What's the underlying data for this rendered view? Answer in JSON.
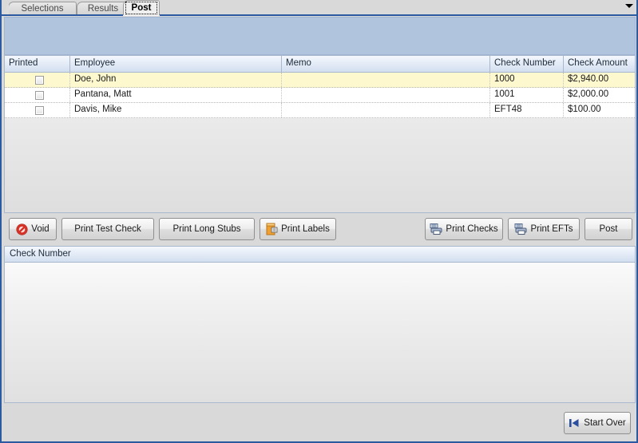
{
  "tabs": [
    {
      "label": "Selections",
      "active": false
    },
    {
      "label": "Results",
      "active": false
    },
    {
      "label": "Post",
      "active": true
    }
  ],
  "titlebar": {
    "dropdown_icon": "chevron-down-icon"
  },
  "grid": {
    "columns": [
      "Printed",
      "Employee",
      "Memo",
      "Check Number",
      "Check Amount"
    ],
    "rows": [
      {
        "printed": false,
        "employee": "Doe, John",
        "memo": "",
        "check_number": "1000",
        "check_amount": "$2,940.00",
        "selected": true
      },
      {
        "printed": false,
        "employee": "Pantana, Matt",
        "memo": "",
        "check_number": "1001",
        "check_amount": "$2,000.00",
        "selected": false
      },
      {
        "printed": false,
        "employee": "Davis, Mike",
        "memo": "",
        "check_number": "EFT48",
        "check_amount": "$100.00",
        "selected": false
      }
    ]
  },
  "toolbar": {
    "void_label": "Void",
    "void_icon": "prohibition-icon",
    "print_test_check_label": "Print Test Check",
    "print_long_stubs_label": "Print Long Stubs",
    "print_labels_label": "Print Labels",
    "print_labels_icon": "label-tag-icon",
    "print_checks_label": "Print Checks",
    "print_checks_icon": "printer-icon",
    "print_efts_label": "Print EFTs",
    "print_efts_icon": "printer-icon",
    "post_label": "Post"
  },
  "lower_panel": {
    "column_header": "Check Number"
  },
  "footer": {
    "start_over_label": "Start Over",
    "start_over_icon": "skip-to-start-icon"
  },
  "colors": {
    "accent_blue": "#2c5aa0",
    "banner_blue": "#b0c4de",
    "selected_row": "#fdf8cd",
    "header_blue": "#d2deef",
    "void_red": "#d93025",
    "label_orange": "#e8941a"
  }
}
